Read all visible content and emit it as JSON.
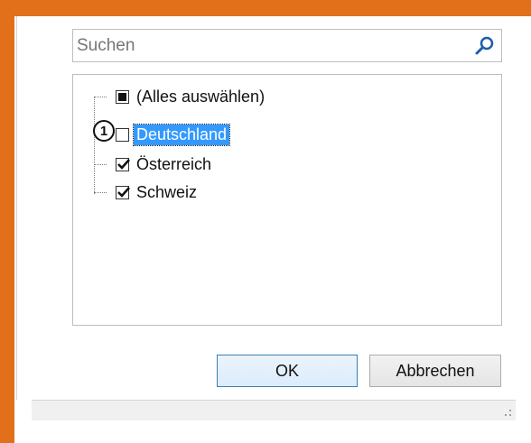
{
  "search": {
    "placeholder": "Suchen",
    "value": ""
  },
  "list": {
    "items": [
      {
        "label": "(Alles auswählen)",
        "state": "partial"
      },
      {
        "label": "Deutschland",
        "state": "unchecked",
        "selected": true
      },
      {
        "label": "Österreich",
        "state": "checked"
      },
      {
        "label": "Schweiz",
        "state": "checked"
      }
    ]
  },
  "callout": {
    "number": "1"
  },
  "buttons": {
    "ok": "OK",
    "cancel": "Abbrechen"
  },
  "colors": {
    "background_accent": "#e2701a",
    "selection": "#3399ff"
  }
}
